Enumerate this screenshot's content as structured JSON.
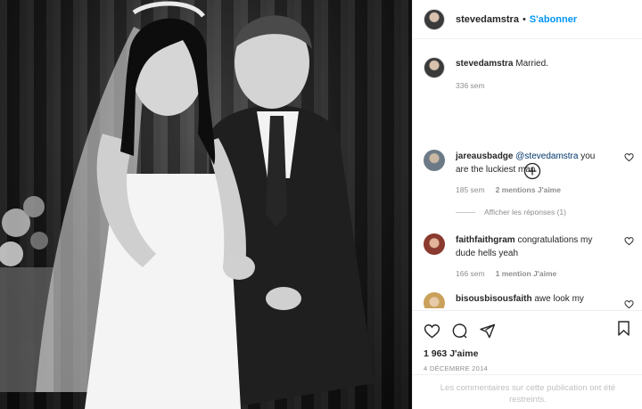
{
  "header": {
    "username": "stevedamstra",
    "separator": "•",
    "follow_label": "S'abonner"
  },
  "caption": {
    "username": "stevedamstra",
    "text": "Married.",
    "time": "336 sem"
  },
  "comments": [
    {
      "username": "jareausbadge",
      "mention": "@stevedamstra",
      "text": " you are the luckiest man",
      "time": "185 sem",
      "likes": "2 mentions J'aime",
      "view_replies": "Afficher les réponses (1)"
    },
    {
      "username": "faithfaithgram",
      "text": "congratulations my dude hells yeah",
      "time": "166 sem",
      "likes": "1 mention J'aime"
    },
    {
      "username": "bisousbisousfaith",
      "text": "awe look my"
    }
  ],
  "footer": {
    "likes": "1 963 J'aime",
    "date": "4 DÉCEMBRE 2014",
    "comments_limited": "Les commentaires sur cette publication ont été restreints."
  },
  "icons": [
    "heart-icon",
    "comment-icon",
    "share-icon",
    "bookmark-icon",
    "add-circle-icon"
  ],
  "colors": {
    "accent": "#0095f6",
    "text": "#262626",
    "muted": "#8e8e8e"
  }
}
